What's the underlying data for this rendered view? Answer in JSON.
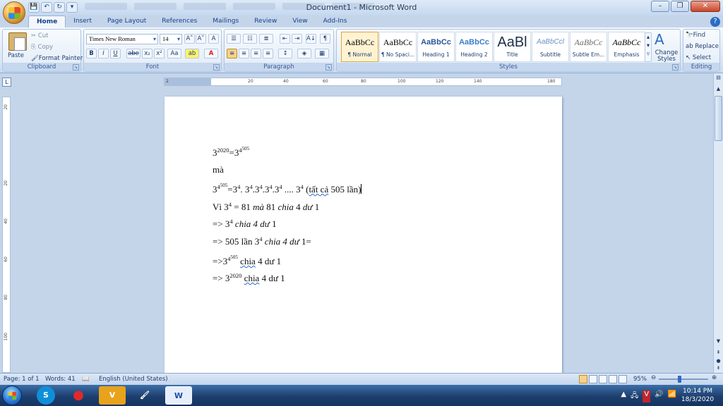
{
  "window": {
    "title": "Document1 - Microsoft Word",
    "controls": [
      "–",
      "❐",
      "✕"
    ]
  },
  "qat": [
    "💾",
    "↶",
    "↻",
    "▾"
  ],
  "ribbon_tabs": [
    "Home",
    "Insert",
    "Page Layout",
    "References",
    "Mailings",
    "Review",
    "View",
    "Add-Ins"
  ],
  "clipboard": {
    "label": "Clipboard",
    "paste": "Paste",
    "cut": "Cut",
    "copy": "Copy",
    "format_painter": "Format Painter"
  },
  "font": {
    "label": "Font",
    "name": "Times New Roman",
    "size": "14",
    "grow": "A˄",
    "shrink": "A˅",
    "clear": "A",
    "bold": "B",
    "italic": "I",
    "underline": "U",
    "strike": "abe",
    "subscript": "x₂",
    "superscript": "x²",
    "change_case": "Aa",
    "highlight": "ab",
    "color": "A"
  },
  "paragraph": {
    "label": "Paragraph",
    "show_marks": "¶",
    "sort": "A↓"
  },
  "styles": {
    "label": "Styles",
    "items": [
      {
        "sample": "AaBbCc",
        "name": "¶ Normal"
      },
      {
        "sample": "AaBbCc",
        "name": "¶ No Spaci..."
      },
      {
        "sample": "AaBbCc",
        "name": "Heading 1"
      },
      {
        "sample": "AaBbCc",
        "name": "Heading 2"
      },
      {
        "sample": "AaBl",
        "name": "Title"
      },
      {
        "sample": "AaBbCcl",
        "name": "Subtitle"
      },
      {
        "sample": "AaBbCc",
        "name": "Subtle Em..."
      },
      {
        "sample": "AaBbCc",
        "name": "Emphasis"
      }
    ],
    "change_styles": "Change Styles"
  },
  "editing": {
    "label": "Editing",
    "find": "Find",
    "replace": "Replace",
    "select": "Select"
  },
  "ruler_ticks": [
    "2",
    "20",
    "40",
    "60",
    "80",
    "100",
    "120",
    "140",
    "180"
  ],
  "vruler_ticks": [
    "20",
    "20",
    "40",
    "60",
    "80",
    "100"
  ],
  "document": {
    "l1_base": "3",
    "l1_exp": "2020",
    "l1_eq": "=3",
    "l1_exp2": "4",
    "l1_exp3": "505",
    "l2": "mà",
    "l3_a": "3",
    "l3_e1": "4",
    "l3_e2": "505",
    "l3_b": "=3",
    "l3_e3": "4",
    "l3_c": ". 3",
    "l3_e4": "4",
    "l3_d": ".3",
    "l3_e5": "4",
    "l3_e": ".3",
    "l3_e6": "4",
    "l3_f": ".3",
    "l3_e7": "4",
    "l3_g": " .... 3",
    "l3_e8": "4",
    "l3_h": " (",
    "l3_squig": "tất cả",
    "l3_i": " 505 lần)",
    "l4_a": "Vì 3",
    "l4_e": "4",
    "l4_b": " = 81 ",
    "l4_c": "mà",
    "l4_d": " 81 ",
    "l4_f": "chia",
    "l4_g": " 4 ",
    "l4_h": "dư",
    "l4_i": " 1",
    "l5_a": "=> 3",
    "l5_e": "4",
    "l5_b": " ",
    "l5_c": "chia 4 dư",
    "l5_d": " 1",
    "l6_a": "=> 505 lần 3",
    "l6_e": "4",
    "l6_b": " ",
    "l6_c": "chia 4 dư",
    "l6_d": " 1=",
    "l7_a": "=>3",
    "l7_e1": "4",
    "l7_e2": "505",
    "l7_b": " ",
    "l7_squig": "chia",
    "l7_c": " 4 dư 1",
    "l8_a": "=> 3",
    "l8_e": "2020",
    "l8_b": " ",
    "l8_squig": "chia",
    "l8_c": " 4 dư 1"
  },
  "status": {
    "page": "Page: 1 of 1",
    "words": "Words: 41",
    "language": "English (United States)",
    "zoom": "95%"
  },
  "taskbar": {
    "apps": [
      "S",
      "●",
      "V",
      "🖌",
      "W"
    ],
    "tray": [
      "▲",
      "🖧",
      "V",
      "🔊",
      "📶"
    ],
    "time": "10:14 PM",
    "date": "18/3/2020"
  }
}
